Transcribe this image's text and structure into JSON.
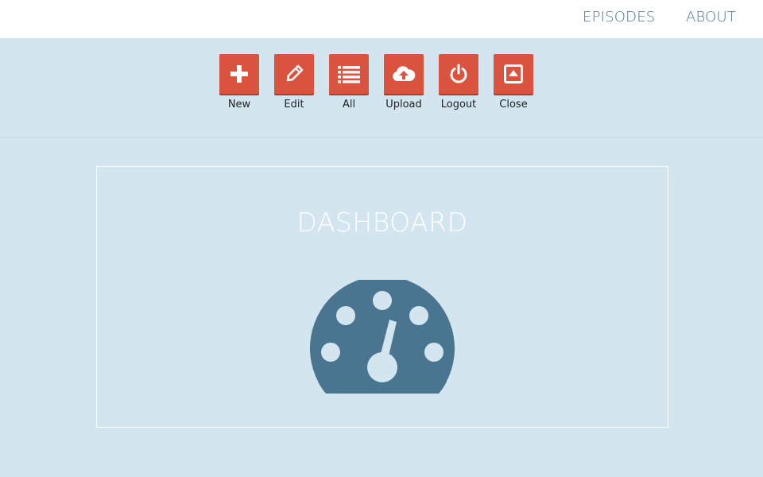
{
  "nav": {
    "episodes": "EPISODES",
    "about": "ABOUT"
  },
  "toolbar": {
    "items": [
      {
        "label": "New",
        "icon": "plus-icon"
      },
      {
        "label": "Edit",
        "icon": "pencil-icon"
      },
      {
        "label": "All",
        "icon": "list-icon"
      },
      {
        "label": "Upload",
        "icon": "cloud-upload-icon"
      },
      {
        "label": "Logout",
        "icon": "power-icon"
      },
      {
        "label": "Close",
        "icon": "close-box-icon"
      }
    ]
  },
  "main": {
    "title": "DASHBOARD",
    "icon": "dashboard-gauge-icon"
  },
  "colors": {
    "background": "#d3e5ef",
    "accent": "#d9533f",
    "nav_text": "#4a7590",
    "gauge": "#4a7590"
  }
}
